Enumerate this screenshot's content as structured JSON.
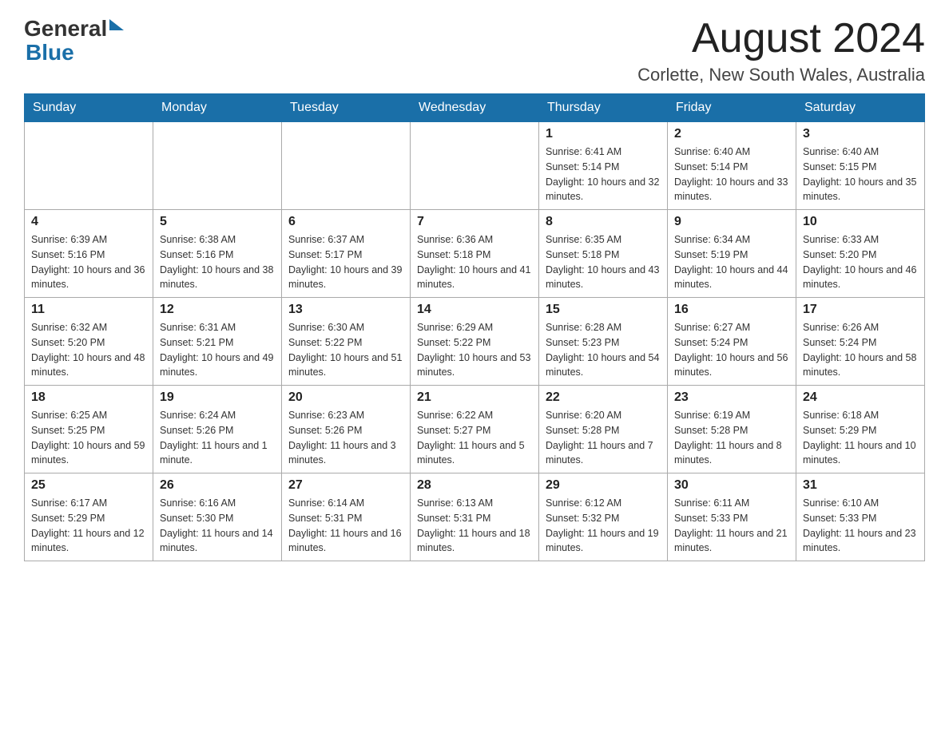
{
  "header": {
    "logo_general": "General",
    "logo_blue": "Blue",
    "month_year": "August 2024",
    "location": "Corlette, New South Wales, Australia"
  },
  "weekdays": [
    "Sunday",
    "Monday",
    "Tuesday",
    "Wednesday",
    "Thursday",
    "Friday",
    "Saturday"
  ],
  "weeks": [
    [
      {
        "day": "",
        "info": ""
      },
      {
        "day": "",
        "info": ""
      },
      {
        "day": "",
        "info": ""
      },
      {
        "day": "",
        "info": ""
      },
      {
        "day": "1",
        "info": "Sunrise: 6:41 AM\nSunset: 5:14 PM\nDaylight: 10 hours and 32 minutes."
      },
      {
        "day": "2",
        "info": "Sunrise: 6:40 AM\nSunset: 5:14 PM\nDaylight: 10 hours and 33 minutes."
      },
      {
        "day": "3",
        "info": "Sunrise: 6:40 AM\nSunset: 5:15 PM\nDaylight: 10 hours and 35 minutes."
      }
    ],
    [
      {
        "day": "4",
        "info": "Sunrise: 6:39 AM\nSunset: 5:16 PM\nDaylight: 10 hours and 36 minutes."
      },
      {
        "day": "5",
        "info": "Sunrise: 6:38 AM\nSunset: 5:16 PM\nDaylight: 10 hours and 38 minutes."
      },
      {
        "day": "6",
        "info": "Sunrise: 6:37 AM\nSunset: 5:17 PM\nDaylight: 10 hours and 39 minutes."
      },
      {
        "day": "7",
        "info": "Sunrise: 6:36 AM\nSunset: 5:18 PM\nDaylight: 10 hours and 41 minutes."
      },
      {
        "day": "8",
        "info": "Sunrise: 6:35 AM\nSunset: 5:18 PM\nDaylight: 10 hours and 43 minutes."
      },
      {
        "day": "9",
        "info": "Sunrise: 6:34 AM\nSunset: 5:19 PM\nDaylight: 10 hours and 44 minutes."
      },
      {
        "day": "10",
        "info": "Sunrise: 6:33 AM\nSunset: 5:20 PM\nDaylight: 10 hours and 46 minutes."
      }
    ],
    [
      {
        "day": "11",
        "info": "Sunrise: 6:32 AM\nSunset: 5:20 PM\nDaylight: 10 hours and 48 minutes."
      },
      {
        "day": "12",
        "info": "Sunrise: 6:31 AM\nSunset: 5:21 PM\nDaylight: 10 hours and 49 minutes."
      },
      {
        "day": "13",
        "info": "Sunrise: 6:30 AM\nSunset: 5:22 PM\nDaylight: 10 hours and 51 minutes."
      },
      {
        "day": "14",
        "info": "Sunrise: 6:29 AM\nSunset: 5:22 PM\nDaylight: 10 hours and 53 minutes."
      },
      {
        "day": "15",
        "info": "Sunrise: 6:28 AM\nSunset: 5:23 PM\nDaylight: 10 hours and 54 minutes."
      },
      {
        "day": "16",
        "info": "Sunrise: 6:27 AM\nSunset: 5:24 PM\nDaylight: 10 hours and 56 minutes."
      },
      {
        "day": "17",
        "info": "Sunrise: 6:26 AM\nSunset: 5:24 PM\nDaylight: 10 hours and 58 minutes."
      }
    ],
    [
      {
        "day": "18",
        "info": "Sunrise: 6:25 AM\nSunset: 5:25 PM\nDaylight: 10 hours and 59 minutes."
      },
      {
        "day": "19",
        "info": "Sunrise: 6:24 AM\nSunset: 5:26 PM\nDaylight: 11 hours and 1 minute."
      },
      {
        "day": "20",
        "info": "Sunrise: 6:23 AM\nSunset: 5:26 PM\nDaylight: 11 hours and 3 minutes."
      },
      {
        "day": "21",
        "info": "Sunrise: 6:22 AM\nSunset: 5:27 PM\nDaylight: 11 hours and 5 minutes."
      },
      {
        "day": "22",
        "info": "Sunrise: 6:20 AM\nSunset: 5:28 PM\nDaylight: 11 hours and 7 minutes."
      },
      {
        "day": "23",
        "info": "Sunrise: 6:19 AM\nSunset: 5:28 PM\nDaylight: 11 hours and 8 minutes."
      },
      {
        "day": "24",
        "info": "Sunrise: 6:18 AM\nSunset: 5:29 PM\nDaylight: 11 hours and 10 minutes."
      }
    ],
    [
      {
        "day": "25",
        "info": "Sunrise: 6:17 AM\nSunset: 5:29 PM\nDaylight: 11 hours and 12 minutes."
      },
      {
        "day": "26",
        "info": "Sunrise: 6:16 AM\nSunset: 5:30 PM\nDaylight: 11 hours and 14 minutes."
      },
      {
        "day": "27",
        "info": "Sunrise: 6:14 AM\nSunset: 5:31 PM\nDaylight: 11 hours and 16 minutes."
      },
      {
        "day": "28",
        "info": "Sunrise: 6:13 AM\nSunset: 5:31 PM\nDaylight: 11 hours and 18 minutes."
      },
      {
        "day": "29",
        "info": "Sunrise: 6:12 AM\nSunset: 5:32 PM\nDaylight: 11 hours and 19 minutes."
      },
      {
        "day": "30",
        "info": "Sunrise: 6:11 AM\nSunset: 5:33 PM\nDaylight: 11 hours and 21 minutes."
      },
      {
        "day": "31",
        "info": "Sunrise: 6:10 AM\nSunset: 5:33 PM\nDaylight: 11 hours and 23 minutes."
      }
    ]
  ]
}
